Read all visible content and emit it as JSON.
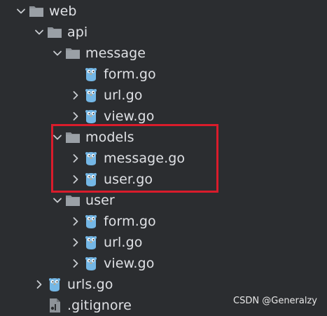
{
  "tree": [
    {
      "label": "web",
      "depth": 0,
      "kind": "folder",
      "expanded": true
    },
    {
      "label": "api",
      "depth": 1,
      "kind": "folder",
      "expanded": true
    },
    {
      "label": "message",
      "depth": 2,
      "kind": "folder",
      "expanded": true
    },
    {
      "label": "form.go",
      "depth": 3,
      "kind": "gofile",
      "chevron": false
    },
    {
      "label": "url.go",
      "depth": 3,
      "kind": "gofile",
      "chevron": true
    },
    {
      "label": "view.go",
      "depth": 3,
      "kind": "gofile",
      "chevron": true
    },
    {
      "label": "models",
      "depth": 2,
      "kind": "folder",
      "expanded": true
    },
    {
      "label": "message.go",
      "depth": 3,
      "kind": "gofile",
      "chevron": true
    },
    {
      "label": "user.go",
      "depth": 3,
      "kind": "gofile",
      "chevron": true
    },
    {
      "label": "user",
      "depth": 2,
      "kind": "folder",
      "expanded": true
    },
    {
      "label": "form.go",
      "depth": 3,
      "kind": "gofile",
      "chevron": true
    },
    {
      "label": "url.go",
      "depth": 3,
      "kind": "gofile",
      "chevron": true
    },
    {
      "label": "view.go",
      "depth": 3,
      "kind": "gofile",
      "chevron": true
    },
    {
      "label": "urls.go",
      "depth": 1,
      "kind": "gofile",
      "chevron": true
    },
    {
      "label": ".gitignore",
      "depth": 1,
      "kind": "textfile",
      "chevron": false
    }
  ],
  "watermark": "CSDN @Generalzy",
  "colors": {
    "background": "#2b2d30",
    "text": "#dfe1e5",
    "folder": "#8d9298",
    "gopher": "#74b7e6",
    "highlight_border": "#d91c2b"
  }
}
